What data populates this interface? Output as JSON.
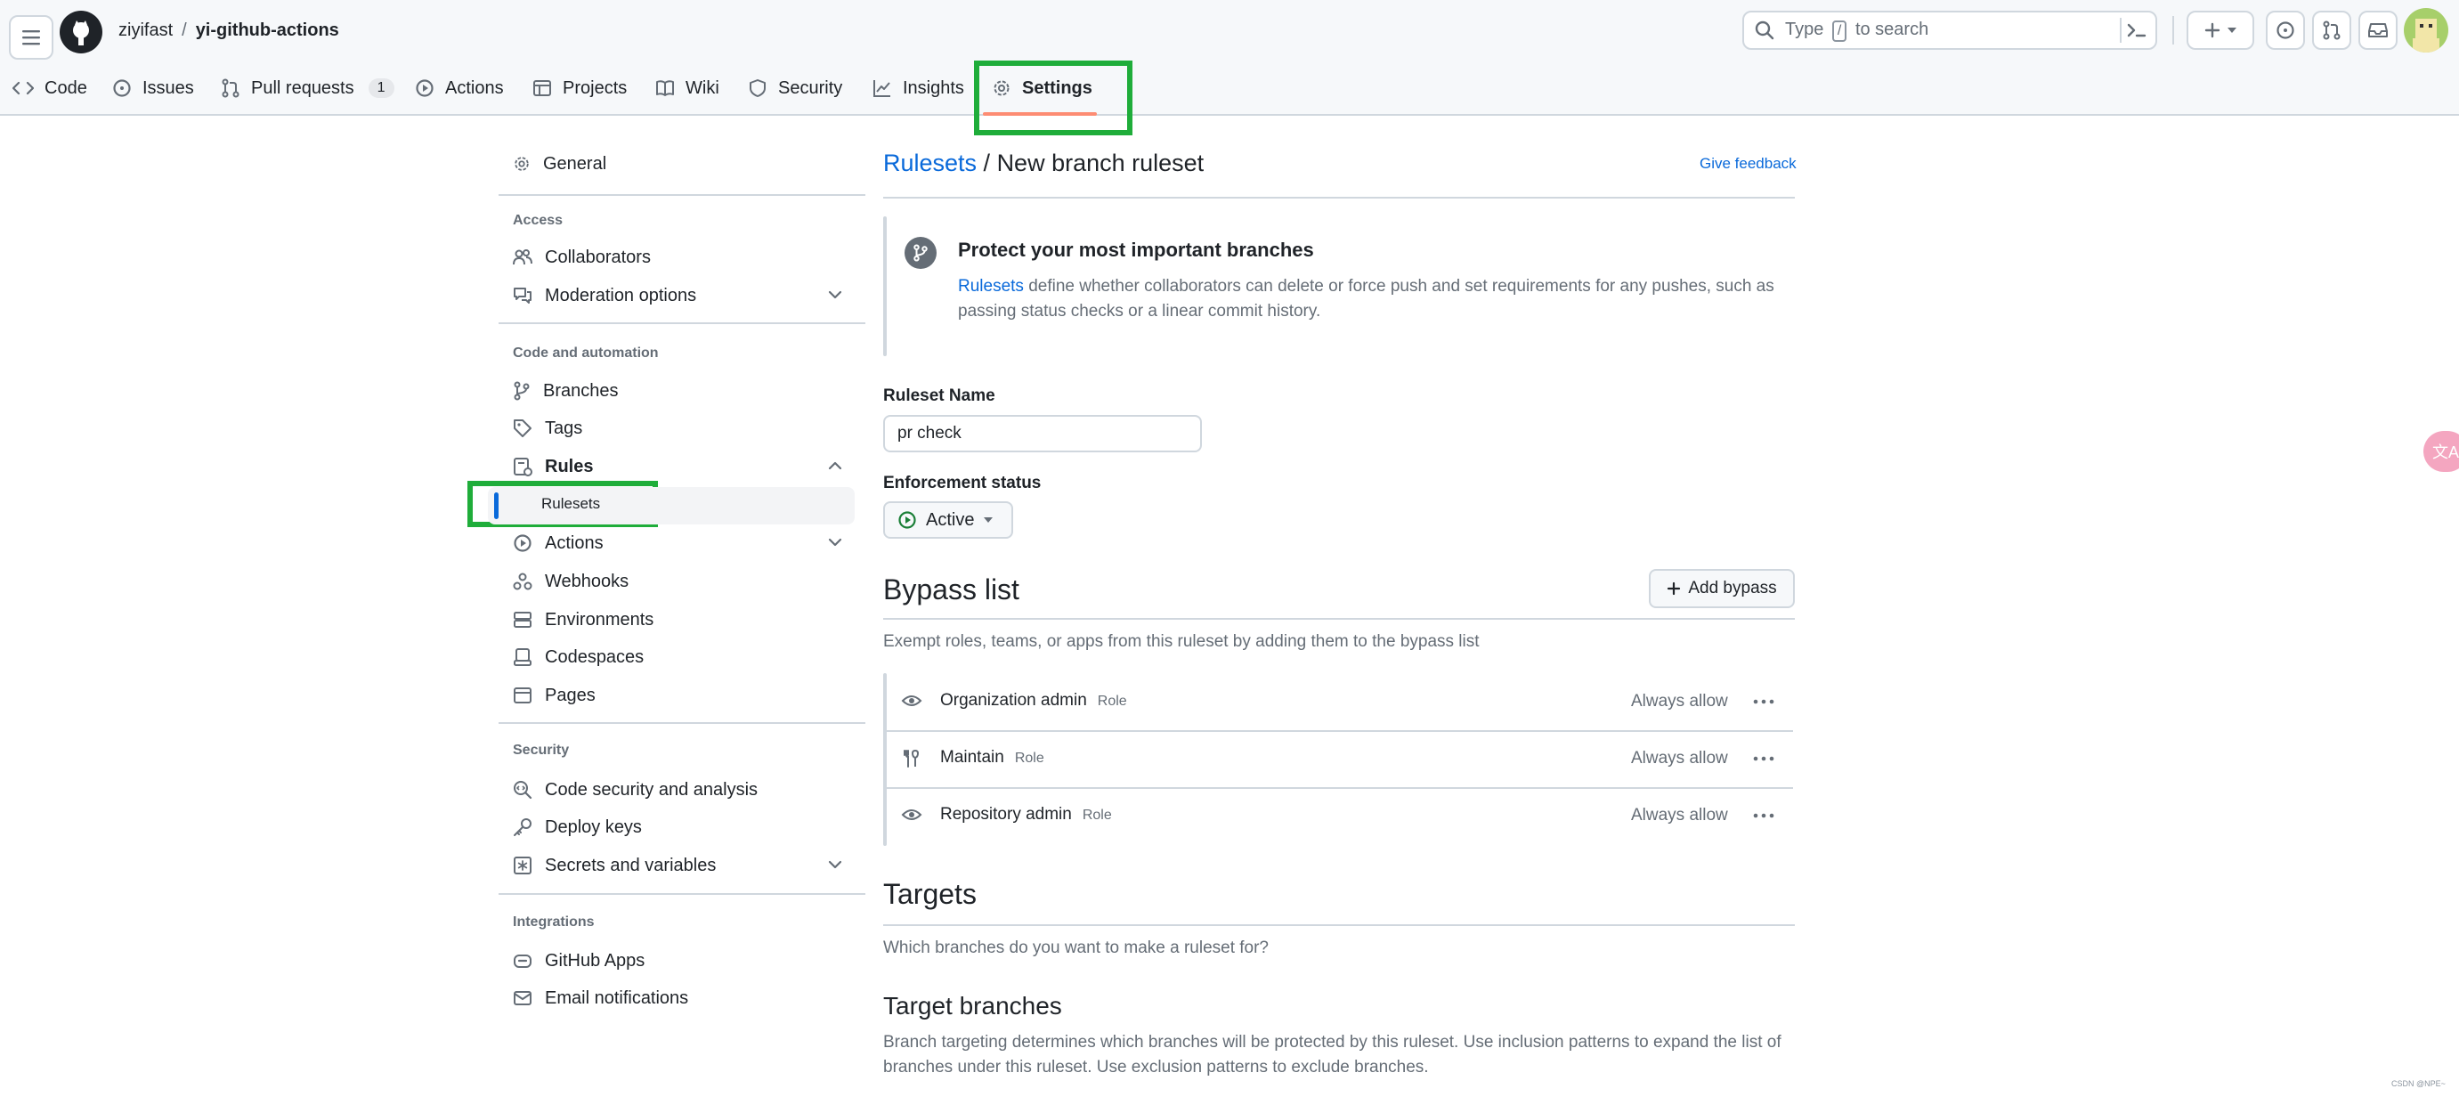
{
  "header": {
    "owner": "ziyifast",
    "separator": "/",
    "repo": "yi-github-actions",
    "search_prefix": "Type",
    "search_key": "/",
    "search_suffix": "to search"
  },
  "repo_nav": {
    "tabs": [
      {
        "label": "Code"
      },
      {
        "label": "Issues"
      },
      {
        "label": "Pull requests",
        "count": "1"
      },
      {
        "label": "Actions"
      },
      {
        "label": "Projects"
      },
      {
        "label": "Wiki"
      },
      {
        "label": "Security"
      },
      {
        "label": "Insights"
      },
      {
        "label": "Settings"
      }
    ],
    "selected": "Settings"
  },
  "sidebar": {
    "general": "General",
    "access_heading": "Access",
    "collaborators": "Collaborators",
    "moderation": "Moderation options",
    "code_heading": "Code and automation",
    "branches": "Branches",
    "tags": "Tags",
    "rules": "Rules",
    "rulesets": "Rulesets",
    "actions": "Actions",
    "webhooks": "Webhooks",
    "environments": "Environments",
    "codespaces": "Codespaces",
    "pages": "Pages",
    "security_heading": "Security",
    "code_security": "Code security and analysis",
    "deploy_keys": "Deploy keys",
    "secrets": "Secrets and variables",
    "integrations_heading": "Integrations",
    "github_apps": "GitHub Apps",
    "email_notifications": "Email notifications"
  },
  "main": {
    "title_link": "Rulesets",
    "title_sep": " / ",
    "title_rest": "New branch ruleset",
    "feedback": "Give feedback",
    "banner_heading": "Protect your most important branches",
    "banner_link": "Rulesets",
    "banner_text": " define whether collaborators can delete or force push and set requirements for any pushes, such as passing status checks or a linear commit history.",
    "ruleset_name_label": "Ruleset Name",
    "ruleset_name_value": "pr check",
    "enforcement_label": "Enforcement status",
    "enforcement_value": "Active",
    "bypass_heading": "Bypass list",
    "add_bypass": "Add bypass",
    "bypass_desc": "Exempt roles, teams, or apps from this ruleset by adding them to the bypass list",
    "bypass_rows": [
      {
        "name": "Organization admin",
        "type": "Role",
        "mode": "Always allow"
      },
      {
        "name": "Maintain",
        "type": "Role",
        "mode": "Always allow"
      },
      {
        "name": "Repository admin",
        "type": "Role",
        "mode": "Always allow"
      }
    ],
    "targets_heading": "Targets",
    "targets_desc": "Which branches do you want to make a ruleset for?",
    "target_branches_heading": "Target branches",
    "target_branches_desc": "Branch targeting determines which branches will be protected by this ruleset. Use inclusion patterns to expand the list of branches under this ruleset. Use exclusion patterns to exclude branches."
  },
  "overlay": {
    "translate_glyph": "文A",
    "watermark": "CSDN @NPE~"
  },
  "colors": {
    "highlight": "#1fad3a",
    "link": "#0969da",
    "selected_underline": "#fd8c73",
    "active_green": "#1a7f37"
  }
}
